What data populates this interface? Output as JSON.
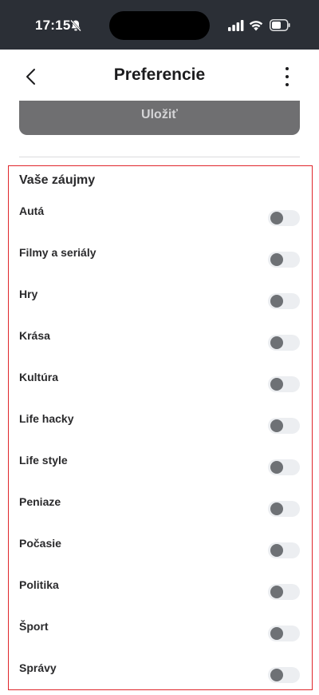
{
  "status_bar": {
    "time": "17:15",
    "icons": [
      "bell-off-icon",
      "signal-icon",
      "wifi-icon",
      "battery-icon"
    ]
  },
  "header": {
    "title": "Preferencie",
    "back_icon": "chevron-left-icon",
    "more_icon": "more-vertical-icon"
  },
  "save_button": {
    "label": "Uložiť"
  },
  "interests": {
    "title": "Vaše záujmy",
    "items": [
      {
        "label": "Autá",
        "enabled": false
      },
      {
        "label": "Filmy a seriály",
        "enabled": false
      },
      {
        "label": "Hry",
        "enabled": false
      },
      {
        "label": "Krása",
        "enabled": false
      },
      {
        "label": "Kultúra",
        "enabled": false
      },
      {
        "label": "Life hacky",
        "enabled": false
      },
      {
        "label": "Life style",
        "enabled": false
      },
      {
        "label": "Peniaze",
        "enabled": false
      },
      {
        "label": "Počasie",
        "enabled": false
      },
      {
        "label": "Politika",
        "enabled": false
      },
      {
        "label": "Šport",
        "enabled": false
      },
      {
        "label": "Správy",
        "enabled": false
      }
    ]
  },
  "colors": {
    "status_bar_bg": "#2b2f36",
    "save_button_bg": "#6f6f71",
    "highlight_border": "#e0262b",
    "toggle_track": "#eceef1",
    "toggle_knob": "#6e7175"
  }
}
